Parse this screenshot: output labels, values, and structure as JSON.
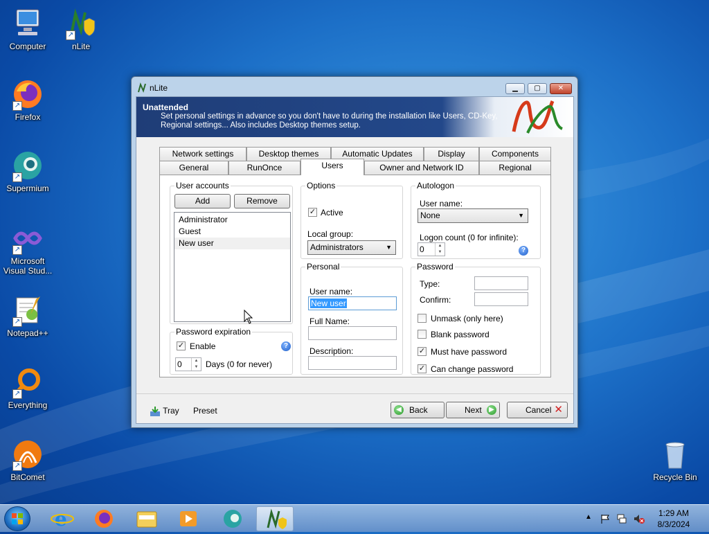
{
  "desktop": {
    "icons": [
      {
        "label": "Computer"
      },
      {
        "label": "nLite"
      },
      {
        "label": "Firefox"
      },
      {
        "label": "Supermium"
      },
      {
        "label": "Microsoft Visual Stud..."
      },
      {
        "label": "Notepad++"
      },
      {
        "label": "Everything"
      },
      {
        "label": "BitComet"
      },
      {
        "label": "Recycle Bin"
      }
    ]
  },
  "window": {
    "title": "nLite",
    "banner": {
      "heading": "Unattended",
      "description": "Set personal settings in advance so you don't have to during the installation like Users, CD-Key, Regional settings... Also includes Desktop themes setup."
    },
    "tabs_row1": [
      "Network settings",
      "Desktop themes",
      "Automatic Updates",
      "Display",
      "Components"
    ],
    "tabs_row2": [
      "General",
      "RunOnce",
      "Users",
      "Owner and Network ID",
      "Regional"
    ],
    "active_tab": "Users",
    "user_accounts": {
      "legend": "User accounts",
      "add_label": "Add",
      "remove_label": "Remove",
      "items": [
        "Administrator",
        "Guest",
        "New user"
      ]
    },
    "password_expiration": {
      "legend": "Password expiration",
      "enable_label": "Enable",
      "enable_checked": true,
      "days_value": "0",
      "days_label": "Days (0 for never)"
    },
    "options": {
      "legend": "Options",
      "active_label": "Active",
      "active_checked": true,
      "local_group_label": "Local group:",
      "local_group_value": "Administrators"
    },
    "personal": {
      "legend": "Personal",
      "user_name_label": "User name:",
      "user_name_value": "New user",
      "full_name_label": "Full Name:",
      "full_name_value": "",
      "description_label": "Description:",
      "description_value": ""
    },
    "autologon": {
      "legend": "Autologon",
      "user_name_label": "User name:",
      "user_name_value": "None",
      "logon_count_label": "Logon count (0 for infinite):",
      "logon_count_value": "0"
    },
    "password": {
      "legend": "Password",
      "type_label": "Type:",
      "confirm_label": "Confirm:",
      "unmask_label": "Unmask (only here)",
      "unmask_checked": false,
      "blank_label": "Blank password",
      "blank_checked": false,
      "must_have_label": "Must have password",
      "must_have_checked": true,
      "can_change_label": "Can change password",
      "can_change_checked": true
    },
    "footer": {
      "tray_label": "Tray",
      "preset_label": "Preset",
      "back_label": "Back",
      "next_label": "Next",
      "cancel_label": "Cancel"
    }
  },
  "taskbar": {
    "time": "1:29 AM",
    "date": "8/3/2024"
  }
}
